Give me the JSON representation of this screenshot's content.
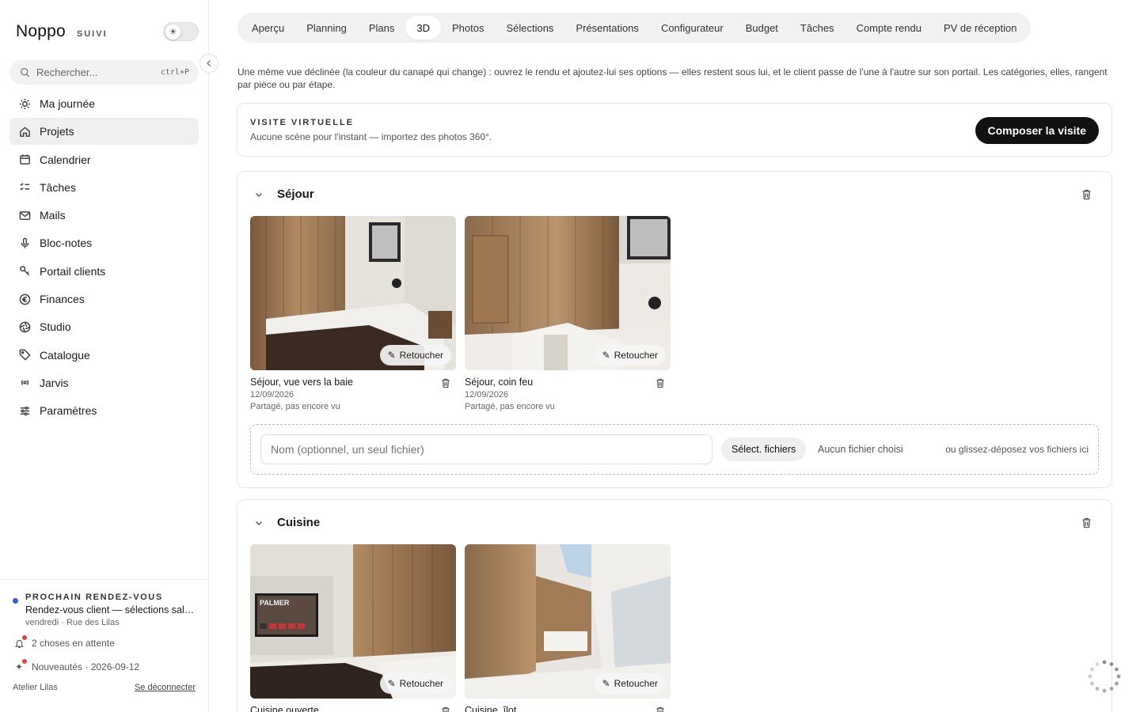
{
  "brand": {
    "name": "Noppo",
    "tag": "SUIVI"
  },
  "search": {
    "placeholder": "Rechercher...",
    "shortcut": "ctrl+P"
  },
  "nav": [
    {
      "label": "Ma journée",
      "icon": "sun-icon",
      "active": false
    },
    {
      "label": "Projets",
      "icon": "home-icon",
      "active": true
    },
    {
      "label": "Calendrier",
      "icon": "calendar-icon",
      "active": false
    },
    {
      "label": "Tâches",
      "icon": "checklist-icon",
      "active": false
    },
    {
      "label": "Mails",
      "icon": "mail-icon",
      "active": false
    },
    {
      "label": "Bloc-notes",
      "icon": "microphone-icon",
      "active": false
    },
    {
      "label": "Portail clients",
      "icon": "key-icon",
      "active": false
    },
    {
      "label": "Finances",
      "icon": "euro-icon",
      "active": false
    },
    {
      "label": "Studio",
      "icon": "aperture-icon",
      "active": false
    },
    {
      "label": "Catalogue",
      "icon": "tag-icon",
      "active": false
    },
    {
      "label": "Jarvis",
      "icon": "broadcast-icon",
      "active": false
    },
    {
      "label": "Paramètres",
      "icon": "sliders-icon",
      "active": false
    }
  ],
  "footer": {
    "rdv_kicker": "PROCHAIN RENDEZ-VOUS",
    "rdv_title": "Rendez-vous client — sélections salle de bain",
    "rdv_sub": "vendredi · Rue des Lilas",
    "pending": "2 choses en attente",
    "news": "Nouveautés · 2026-09-12",
    "workspace": "Atelier Lilas",
    "logout": "Se déconnecter"
  },
  "tabs": [
    {
      "label": "Aperçu",
      "active": false
    },
    {
      "label": "Planning",
      "active": false
    },
    {
      "label": "Plans",
      "active": false
    },
    {
      "label": "3D",
      "active": true
    },
    {
      "label": "Photos",
      "active": false
    },
    {
      "label": "Sélections",
      "active": false
    },
    {
      "label": "Présentations",
      "active": false
    },
    {
      "label": "Configurateur",
      "active": false
    },
    {
      "label": "Budget",
      "active": false
    },
    {
      "label": "Tâches",
      "active": false
    },
    {
      "label": "Compte rendu",
      "active": false
    },
    {
      "label": "PV de réception",
      "active": false
    }
  ],
  "intro": "Une même vue déclinée (la couleur du canapé qui change) : ouvrez le rendu et ajoutez-lui ses options — elles restent sous lui, et le client passe de l'une à l'autre sur son portail. Les catégories, elles, rangent par pièce ou par étape.",
  "visit": {
    "kicker": "VISITE VIRTUELLE",
    "sub": "Aucune scène pour l'instant — importez des photos 360°.",
    "button": "Composer la visite"
  },
  "sections": [
    {
      "title": "Séjour",
      "photos": [
        {
          "title": "Séjour, vue vers la baie",
          "date": "12/09/2026",
          "status": "Partagé, pas encore vu",
          "retouch": "Retoucher"
        },
        {
          "title": "Séjour, coin feu",
          "date": "12/09/2026",
          "status": "Partagé, pas encore vu",
          "retouch": "Retoucher"
        }
      ],
      "upload": {
        "placeholder": "Nom (optionnel, un seul fichier)",
        "button": "Sélect. fichiers",
        "none": "Aucun fichier choisi",
        "drop": "ou glissez-déposez vos fichiers ici"
      }
    },
    {
      "title": "Cuisine",
      "photos": [
        {
          "title": "Cuisine ouverte",
          "retouch": "Retoucher",
          "tv_text": "PALMER"
        },
        {
          "title": "Cuisine, îlot",
          "retouch": "Retoucher"
        }
      ]
    }
  ],
  "colors": {
    "accent": "#111111",
    "rdv_dot": "#3a5bd9",
    "alert_dot": "#e0433a"
  }
}
